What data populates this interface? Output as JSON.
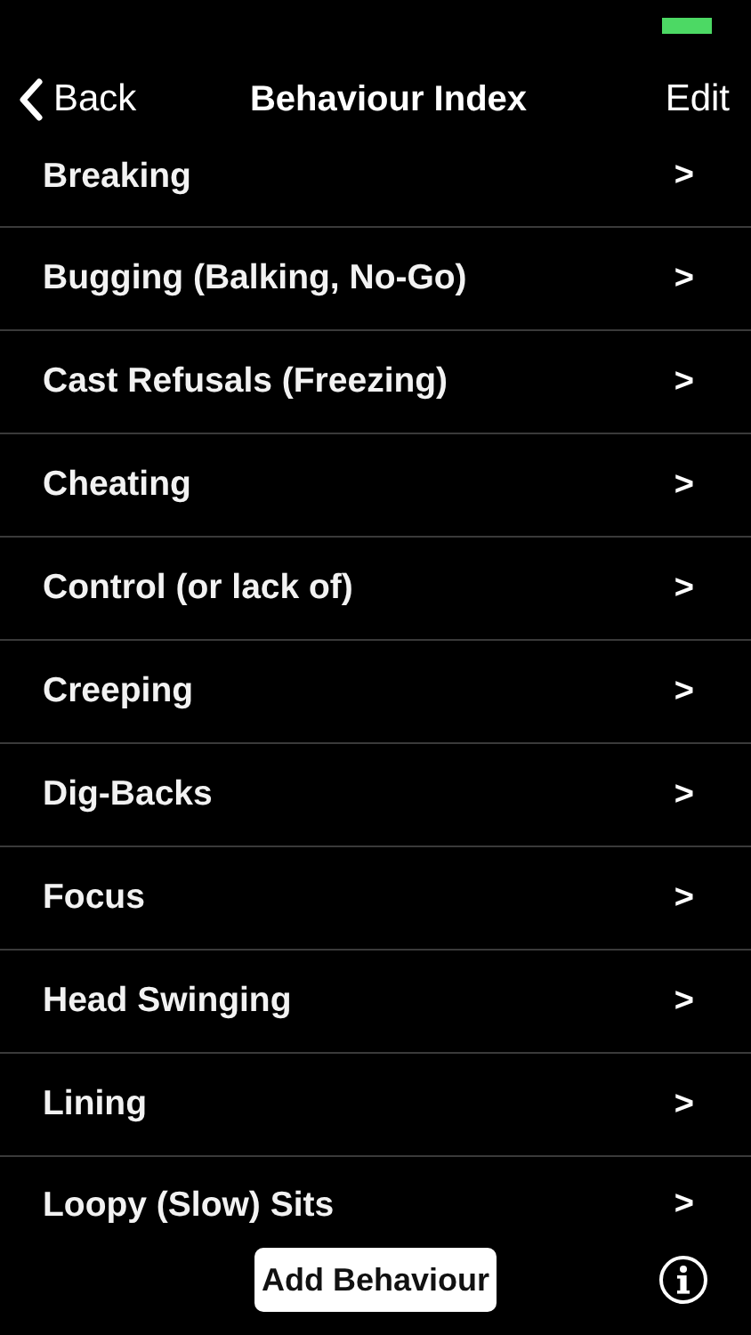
{
  "nav_bar": {
    "back": "Back",
    "title": "Behaviour Index",
    "edit": "Edit"
  },
  "items": [
    {
      "label": "Breaking",
      "chevron": ">"
    },
    {
      "label": "Bugging (Balking, No-Go)",
      "chevron": ">"
    },
    {
      "label": "Cast Refusals (Freezing)",
      "chevron": ">"
    },
    {
      "label": "Cheating",
      "chevron": ">"
    },
    {
      "label": "Control (or lack of)",
      "chevron": ">"
    },
    {
      "label": "Creeping",
      "chevron": ">"
    },
    {
      "label": "Dig-Backs",
      "chevron": ">"
    },
    {
      "label": "Focus",
      "chevron": ">"
    },
    {
      "label": "Head Swinging",
      "chevron": ">"
    },
    {
      "label": "Lining",
      "chevron": ">"
    },
    {
      "label": "Loopy (Slow) Sits",
      "chevron": ">"
    }
  ],
  "toolbar": {
    "button": "Add Behaviour"
  }
}
